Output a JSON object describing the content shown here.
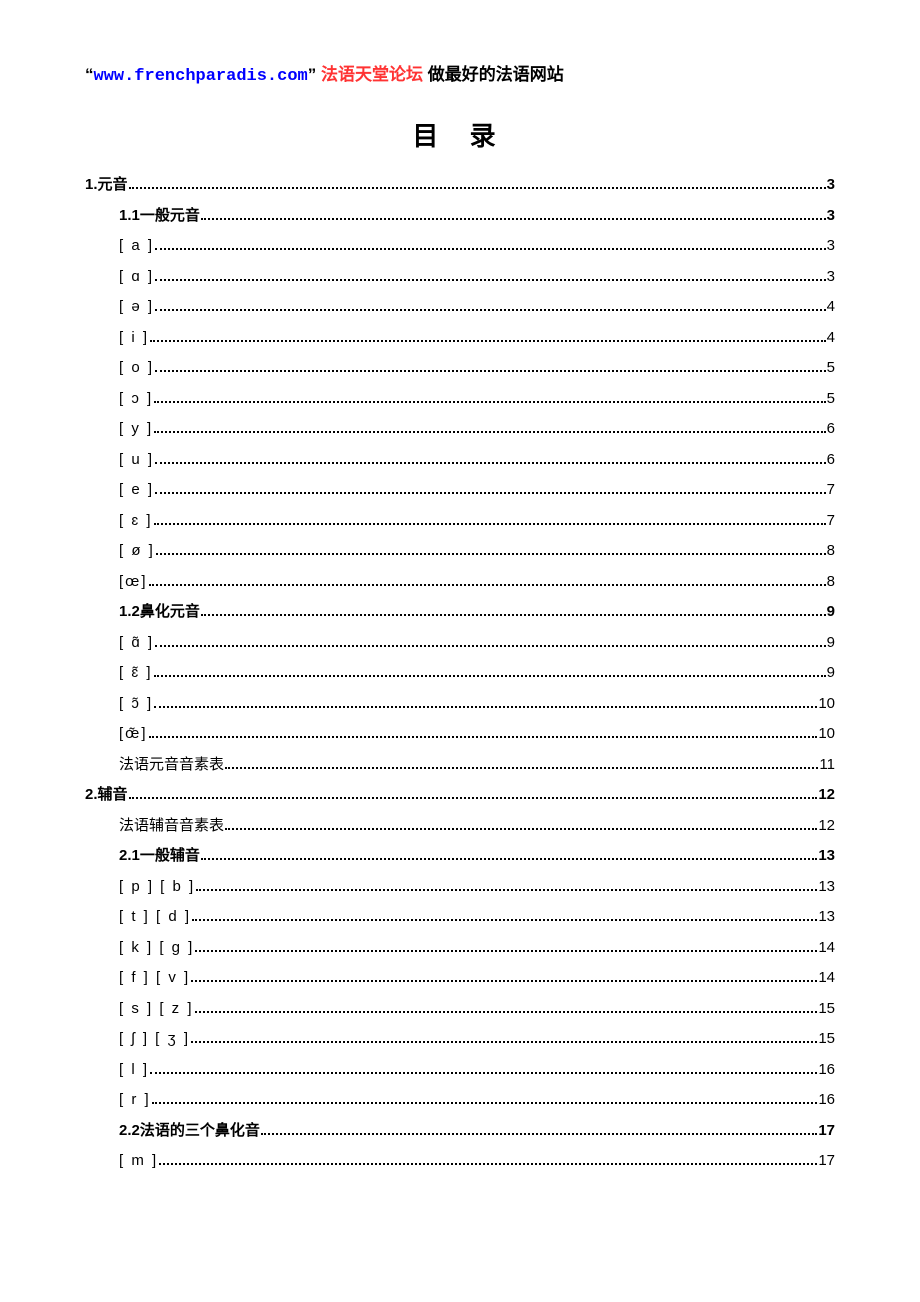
{
  "header": {
    "quote_open": "“",
    "url": "www.frenchparadis.com",
    "quote_close": "”",
    "red_text": "法语天堂论坛",
    "black_text": "做最好的法语网站"
  },
  "title": "目 录",
  "toc": [
    {
      "level": 0,
      "num": "1.",
      "label": "元音",
      "page": "3",
      "bold": true,
      "ipa": false
    },
    {
      "level": 1,
      "num": "1.1",
      "label": "一般元音",
      "page": "3",
      "bold": true,
      "ipa": false
    },
    {
      "level": 1,
      "num": "",
      "label": "[ a ]",
      "page": "3",
      "bold": false,
      "ipa": true
    },
    {
      "level": 1,
      "num": "",
      "label": "[ ɑ ]",
      "page": "3",
      "bold": false,
      "ipa": true
    },
    {
      "level": 1,
      "num": "",
      "label": "[ ə ]",
      "page": "4",
      "bold": false,
      "ipa": true
    },
    {
      "level": 1,
      "num": "",
      "label": "[ i ]",
      "page": "4",
      "bold": false,
      "ipa": true
    },
    {
      "level": 1,
      "num": "",
      "label": "[ o ]",
      "page": "5",
      "bold": false,
      "ipa": true
    },
    {
      "level": 1,
      "num": "",
      "label": "[ ɔ ]",
      "page": "5",
      "bold": false,
      "ipa": true
    },
    {
      "level": 1,
      "num": "",
      "label": "[ y ]",
      "page": "6",
      "bold": false,
      "ipa": true
    },
    {
      "level": 1,
      "num": "",
      "label": "[ u ]",
      "page": "6",
      "bold": false,
      "ipa": true
    },
    {
      "level": 1,
      "num": "",
      "label": "[ e ]",
      "page": "7",
      "bold": false,
      "ipa": true
    },
    {
      "level": 1,
      "num": "",
      "label": "[ ɛ ]",
      "page": "7",
      "bold": false,
      "ipa": true
    },
    {
      "level": 1,
      "num": "",
      "label": "[ ø ]",
      "page": "8",
      "bold": false,
      "ipa": true
    },
    {
      "level": 1,
      "num": "",
      "label": "[œ]",
      "page": "8",
      "bold": false,
      "ipa": true
    },
    {
      "level": 1,
      "num": "1.2",
      "label": "鼻化元音",
      "page": "9",
      "bold": true,
      "ipa": false
    },
    {
      "level": 1,
      "num": "",
      "label": "[ ɑ̃ ]",
      "page": "9",
      "bold": false,
      "ipa": true
    },
    {
      "level": 1,
      "num": "",
      "label": "[ ɛ̃ ]",
      "page": "9",
      "bold": false,
      "ipa": true
    },
    {
      "level": 1,
      "num": "",
      "label": "[ ɔ̃ ]",
      "page": "10",
      "bold": false,
      "ipa": true
    },
    {
      "level": 1,
      "num": "",
      "label": "[œ̃]",
      "page": "10",
      "bold": false,
      "ipa": true
    },
    {
      "level": 1,
      "num": "",
      "label": "法语元音音素表",
      "page": "11",
      "bold": false,
      "ipa": false
    },
    {
      "level": 0,
      "num": "2.",
      "label": "辅音",
      "page": "12",
      "bold": true,
      "ipa": false
    },
    {
      "level": 1,
      "num": "",
      "label": "法语辅音音素表",
      "page": "12",
      "bold": false,
      "ipa": false
    },
    {
      "level": 1,
      "num": "2.1",
      "label": "一般辅音",
      "page": "13",
      "bold": true,
      "ipa": false
    },
    {
      "level": 1,
      "num": "",
      "label": "[ p ] [ b ]",
      "page": "13",
      "bold": false,
      "ipa": true
    },
    {
      "level": 1,
      "num": "",
      "label": "[ t ] [ d ]",
      "page": "13",
      "bold": false,
      "ipa": true
    },
    {
      "level": 1,
      "num": "",
      "label": "[ k ] [ g ]",
      "page": "14",
      "bold": false,
      "ipa": true
    },
    {
      "level": 1,
      "num": "",
      "label": "[ f ] [ v ]",
      "page": "14",
      "bold": false,
      "ipa": true
    },
    {
      "level": 1,
      "num": "",
      "label": "[ s ] [ z ]",
      "page": "15",
      "bold": false,
      "ipa": true
    },
    {
      "level": 1,
      "num": "",
      "label": "[ ʃ ] [ ʒ ]",
      "page": "15",
      "bold": false,
      "ipa": true
    },
    {
      "level": 1,
      "num": "",
      "label": "[ l ]",
      "page": "16",
      "bold": false,
      "ipa": true
    },
    {
      "level": 1,
      "num": "",
      "label": "[ r ]",
      "page": "16",
      "bold": false,
      "ipa": true
    },
    {
      "level": 1,
      "num": "2.2",
      "label": "法语的三个鼻化音",
      "page": "17",
      "bold": true,
      "ipa": false
    },
    {
      "level": 1,
      "num": "",
      "label": "[ m ]",
      "page": "17",
      "bold": false,
      "ipa": true
    }
  ]
}
